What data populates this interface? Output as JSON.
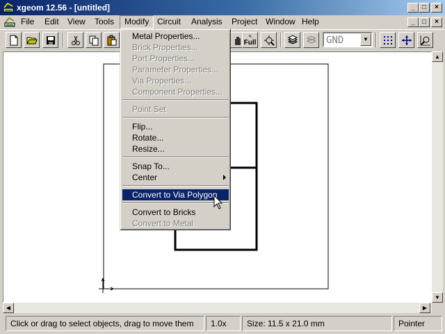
{
  "window": {
    "title": "xgeom 12.56 - [untitled]",
    "min_glyph": "_",
    "max_glyph": "□",
    "close_glyph": "×"
  },
  "menubar": {
    "items": [
      "File",
      "Edit",
      "View",
      "Tools",
      "Modify",
      "Circuit",
      "Analysis",
      "Project",
      "Window",
      "Help"
    ],
    "open_item": "Modify"
  },
  "toolbar": {
    "full_label": "Full",
    "layer_value": "GND"
  },
  "modify_menu": {
    "items": [
      {
        "label": "Metal Properties...",
        "state": "enabled"
      },
      {
        "label": "Brick Properties...",
        "state": "disabled"
      },
      {
        "label": "Port Properties...",
        "state": "disabled"
      },
      {
        "label": "Parameter Properties...",
        "state": "disabled"
      },
      {
        "label": "Via Properties...",
        "state": "disabled"
      },
      {
        "label": "Component Properties...",
        "state": "disabled"
      },
      {
        "label": "Point Set",
        "state": "disabled"
      },
      {
        "label": "Flip...",
        "state": "enabled"
      },
      {
        "label": "Rotate...",
        "state": "enabled"
      },
      {
        "label": "Resize...",
        "state": "enabled"
      },
      {
        "label": "Snap To...",
        "state": "enabled"
      },
      {
        "label": "Center",
        "state": "enabled",
        "submenu": true
      },
      {
        "label": "Convert to Via Polygon",
        "state": "selected"
      },
      {
        "label": "Convert to Bricks",
        "state": "enabled"
      },
      {
        "label": "Convert to Metal",
        "state": "disabled"
      }
    ]
  },
  "statusbar": {
    "hint": "Click or drag to select objects, drag to move them",
    "zoom": "1.0x",
    "size": "Size: 11.5 x 21.0 mm",
    "mode": "Pointer"
  },
  "colors": {
    "title_active": "#0a246a",
    "face": "#d4d0c8",
    "menu_highlight": "#0a246a",
    "canvas": "#ffffff"
  }
}
